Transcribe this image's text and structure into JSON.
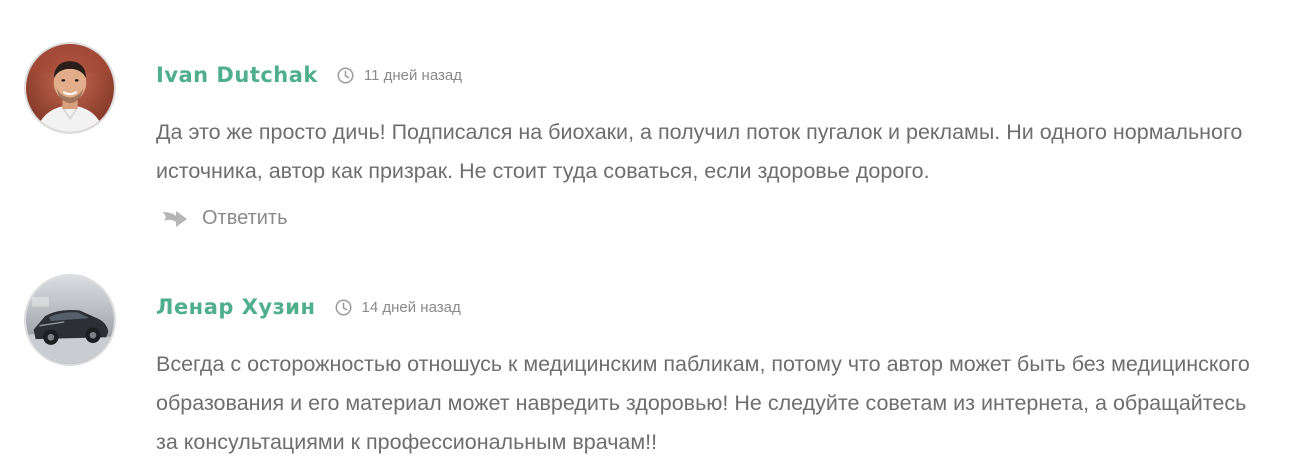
{
  "comments": [
    {
      "author": "Ivan Dutchak",
      "time": "11 дней назад",
      "text": "Да это же просто дичь! Подписался на биохаки, а получил поток пугалок и рекламы. Ни одного нормального источника, автор как призрак. Не стоит туда соваться, если здоровье дорого.",
      "reply_label": "Ответить",
      "avatar_icon": "person-photo-avatar"
    },
    {
      "author": "Ленар Хузин",
      "time": "14 дней назад",
      "text": "Всегда с осторожностью отношусь к медицинским пабликам, потому что автор может быть без медицинского образования и его материал может навредить здоровью! Не следуйте советам из интернета, а обращайтесь за консультациями к профессиональным врачам!!",
      "avatar_icon": "car-photo-avatar"
    }
  ],
  "icons": {
    "time": "clock-icon",
    "reply": "reply-arrow-icon"
  },
  "colors": {
    "author": "#4fae8c",
    "text": "#6e6e6e",
    "meta": "#8a8a8a",
    "icon": "#b5b5b5",
    "avatar_border": "#dddddd"
  }
}
